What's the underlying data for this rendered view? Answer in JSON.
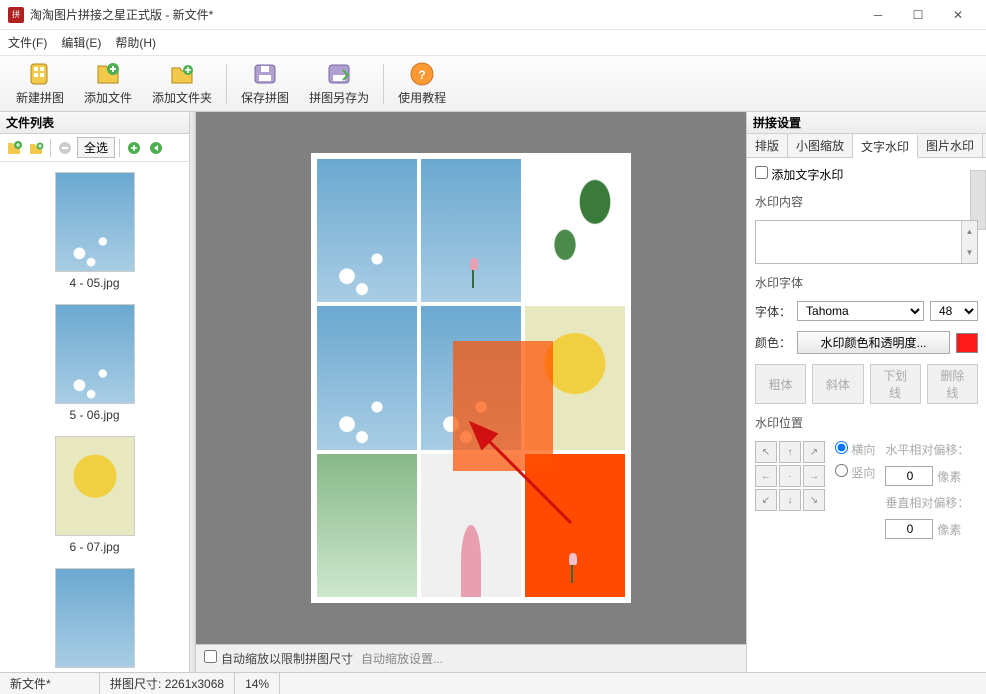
{
  "title": "淘淘图片拼接之星正式版 - 新文件*",
  "menu": {
    "file": "文件(F)",
    "edit": "编辑(E)",
    "help": "帮助(H)"
  },
  "toolbar": {
    "new": "新建拼图",
    "addfile": "添加文件",
    "addfolder": "添加文件夹",
    "save": "保存拼图",
    "saveas": "拼图另存为",
    "tutorial": "使用教程"
  },
  "left": {
    "title": "文件列表",
    "select_all": "全选",
    "thumbs": [
      {
        "name": "4 - 05.jpg"
      },
      {
        "name": "5 - 06.jpg"
      },
      {
        "name": "6 - 07.jpg"
      }
    ]
  },
  "canvas": {
    "footer_checkbox": "自动缩放以限制拼图尺寸",
    "footer_link": "自动缩放设置..."
  },
  "right": {
    "title": "拼接设置",
    "tabs": {
      "layout": "排版",
      "thumb": "小图缩放",
      "textwm": "文字水印",
      "imgwm": "图片水印"
    },
    "add_text_wm": "添加文字水印",
    "content_label": "水印内容",
    "font_section": "水印字体",
    "font_label": "字体：",
    "font_value": "Tahoma",
    "size_value": "48",
    "color_label": "颜色：",
    "color_btn": "水印颜色和透明度...",
    "bold": "粗体",
    "italic": "斜体",
    "underline": "下划线",
    "strike": "删除线",
    "pos_section": "水印位置",
    "horiz": "横向",
    "vert": "竖向",
    "hoffset_label": "水平相对偏移：",
    "voffset_label": "垂直相对偏移：",
    "offset_value": "0",
    "px": "像素"
  },
  "status": {
    "file": "新文件*",
    "size_label": "拼图尺寸:",
    "size": "2261x3068",
    "zoom": "14%"
  }
}
